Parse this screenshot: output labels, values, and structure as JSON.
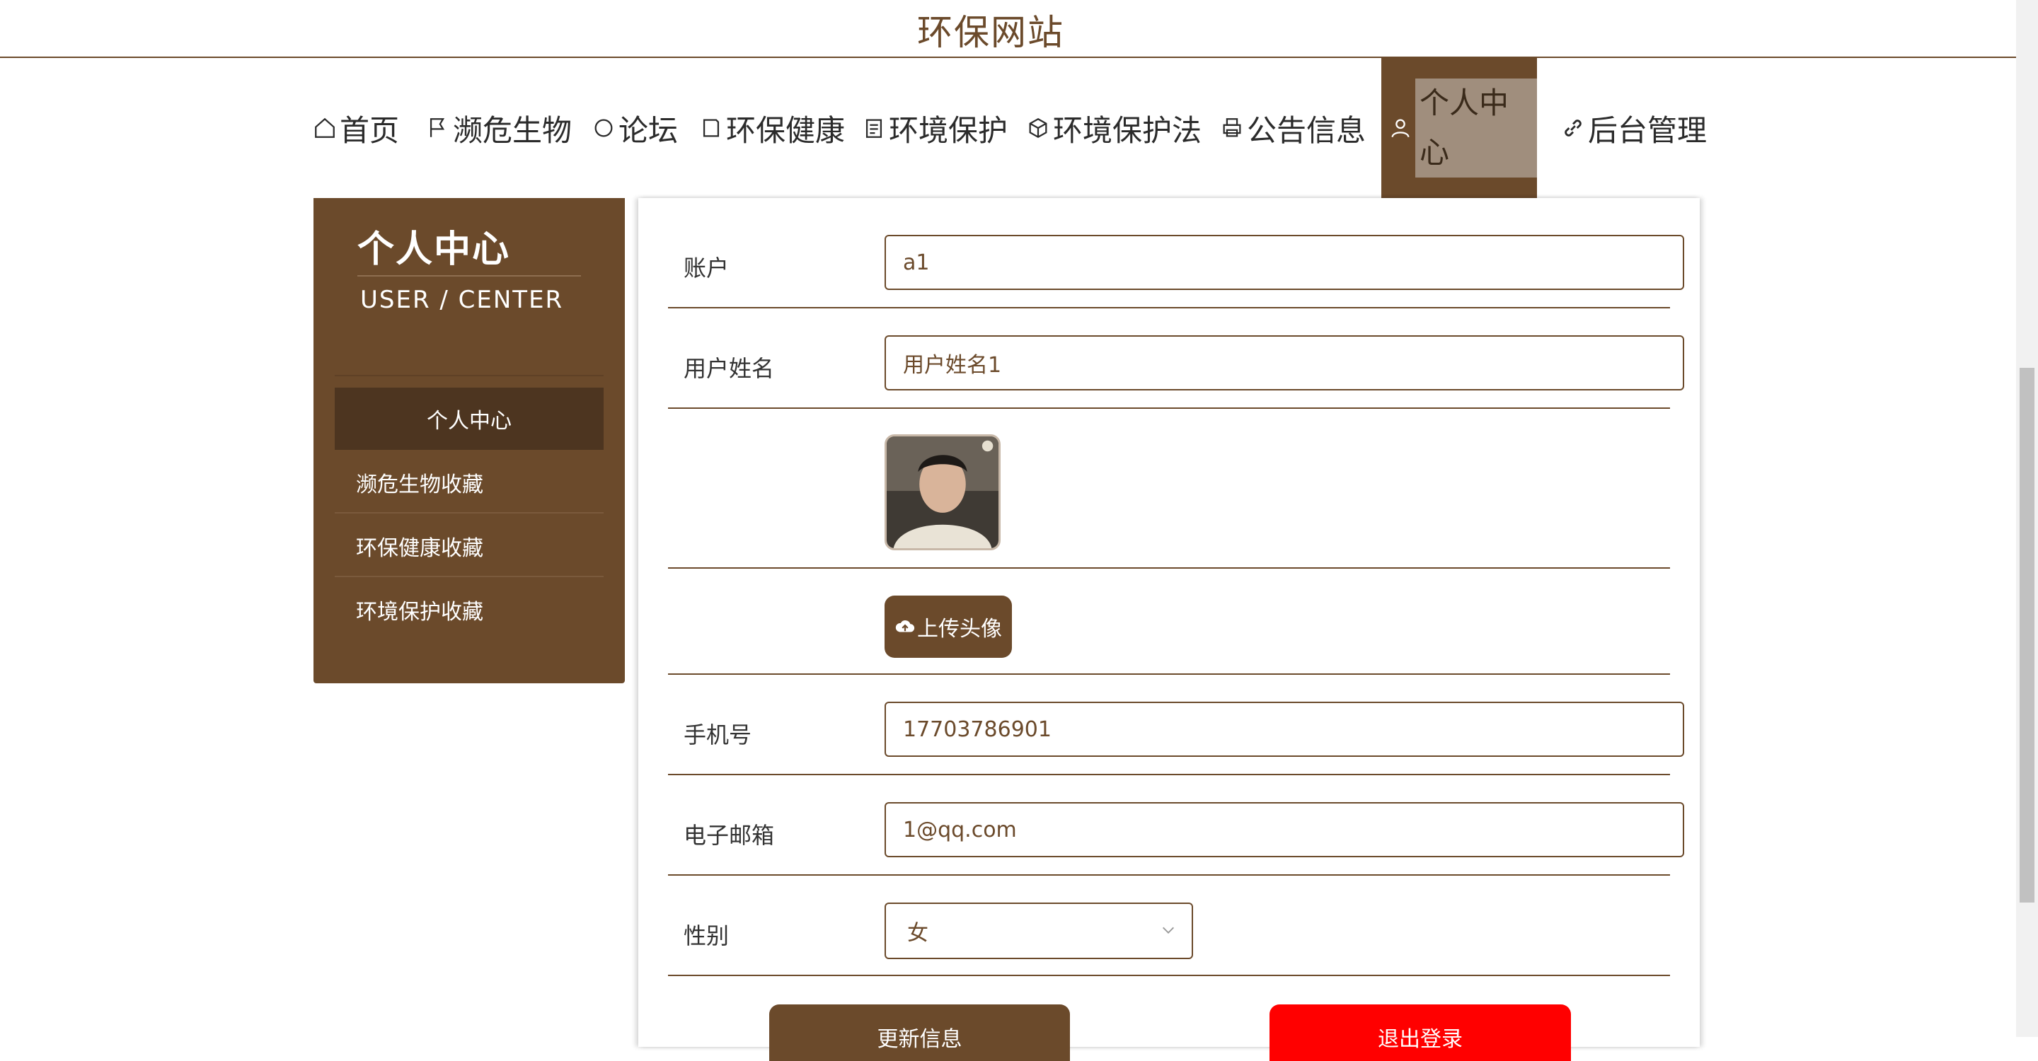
{
  "site": {
    "title": "环保网站"
  },
  "nav": [
    {
      "label": "首页",
      "icon": "home-icon"
    },
    {
      "label": "濒危生物",
      "icon": "flag-icon"
    },
    {
      "label": "论坛",
      "icon": "chat-circle-icon"
    },
    {
      "label": "环保健康",
      "icon": "document-icon"
    },
    {
      "label": "环境保护",
      "icon": "clipboard-icon"
    },
    {
      "label": "环境保护法",
      "icon": "box-icon"
    },
    {
      "label": "公告信息",
      "icon": "printer-icon"
    },
    {
      "label": "个人中心",
      "icon": "user-icon",
      "active": true
    },
    {
      "label": "后台管理",
      "icon": "link-icon"
    }
  ],
  "sidebar": {
    "title": "个人中心",
    "subtitle": "USER / CENTER",
    "items": [
      {
        "label": "个人中心",
        "active": true
      },
      {
        "label": "濒危生物收藏"
      },
      {
        "label": "环保健康收藏"
      },
      {
        "label": "环境保护收藏"
      }
    ]
  },
  "form": {
    "account_label": "账户",
    "account_value": "a1",
    "username_label": "用户姓名",
    "username_value": "用户姓名1",
    "upload_label": "上传头像",
    "phone_label": "手机号",
    "phone_value": "17703786901",
    "email_label": "电子邮箱",
    "email_value": "1@qq.com",
    "gender_label": "性别",
    "gender_value": "女"
  },
  "actions": {
    "update_label": "更新信息",
    "logout_label": "退出登录"
  },
  "colors": {
    "brand_brown": "#6b4a2b",
    "logout_red": "#ff0000"
  }
}
